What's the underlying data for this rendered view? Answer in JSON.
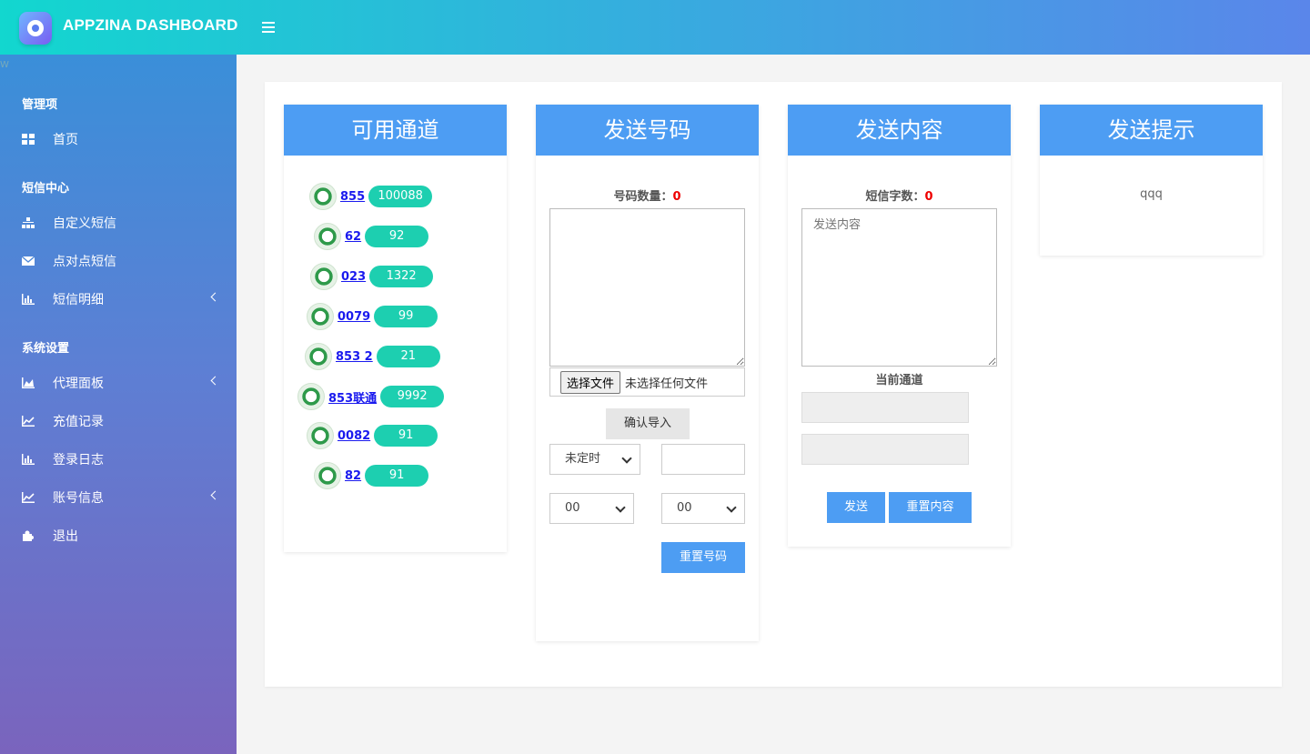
{
  "header": {
    "app_title": "APPZINA DASHBOARD"
  },
  "sidebar": {
    "corner_text": "W",
    "sections": [
      {
        "title": "管理项",
        "items": [
          {
            "label": "首页",
            "icon": "grid-icon"
          }
        ]
      },
      {
        "title": "短信中心",
        "items": [
          {
            "label": "自定义短信",
            "icon": "sitemap-icon"
          },
          {
            "label": "点对点短信",
            "icon": "envelope-icon"
          },
          {
            "label": "短信明细",
            "icon": "bar-chart-icon",
            "expandable": true
          }
        ]
      },
      {
        "title": "系统设置",
        "items": [
          {
            "label": "代理面板",
            "icon": "area-chart-icon",
            "expandable": true
          },
          {
            "label": "充值记录",
            "icon": "line-chart-icon"
          },
          {
            "label": "登录日志",
            "icon": "bar-chart-icon"
          },
          {
            "label": "账号信息",
            "icon": "line-chart-icon",
            "expandable": true
          },
          {
            "label": "退出",
            "icon": "puzzle-icon"
          }
        ]
      }
    ]
  },
  "channels": {
    "title": "可用通道",
    "items": [
      {
        "code": "855",
        "count": "100088"
      },
      {
        "code": "62",
        "count": "92"
      },
      {
        "code": "023",
        "count": "1322"
      },
      {
        "code": "0079",
        "count": "99"
      },
      {
        "code": "853 2",
        "count": "21"
      },
      {
        "code": "853联通",
        "count": "9992"
      },
      {
        "code": "0082",
        "count": "91"
      },
      {
        "code": "82",
        "count": "91"
      }
    ]
  },
  "numbers": {
    "title": "发送号码",
    "count_label": "号码数量：",
    "count_value": "0",
    "file_button": "选择文件",
    "file_status": "未选择任何文件",
    "confirm_import": "确认导入",
    "schedule_select": "未定时",
    "hour_select": "00",
    "minute_select": "00",
    "reset_button": "重置号码"
  },
  "content": {
    "title": "发送内容",
    "chars_label": "短信字数：",
    "chars_value": "0",
    "textarea_placeholder": "发送内容",
    "current_channel_label": "当前通道",
    "send_button": "发送",
    "reset_button": "重置内容"
  },
  "tips": {
    "title": "发送提示",
    "text": "qqq"
  },
  "colors": {
    "accent": "#4d9df3",
    "pill": "#1dcfb0",
    "link": "#1a1aee"
  }
}
